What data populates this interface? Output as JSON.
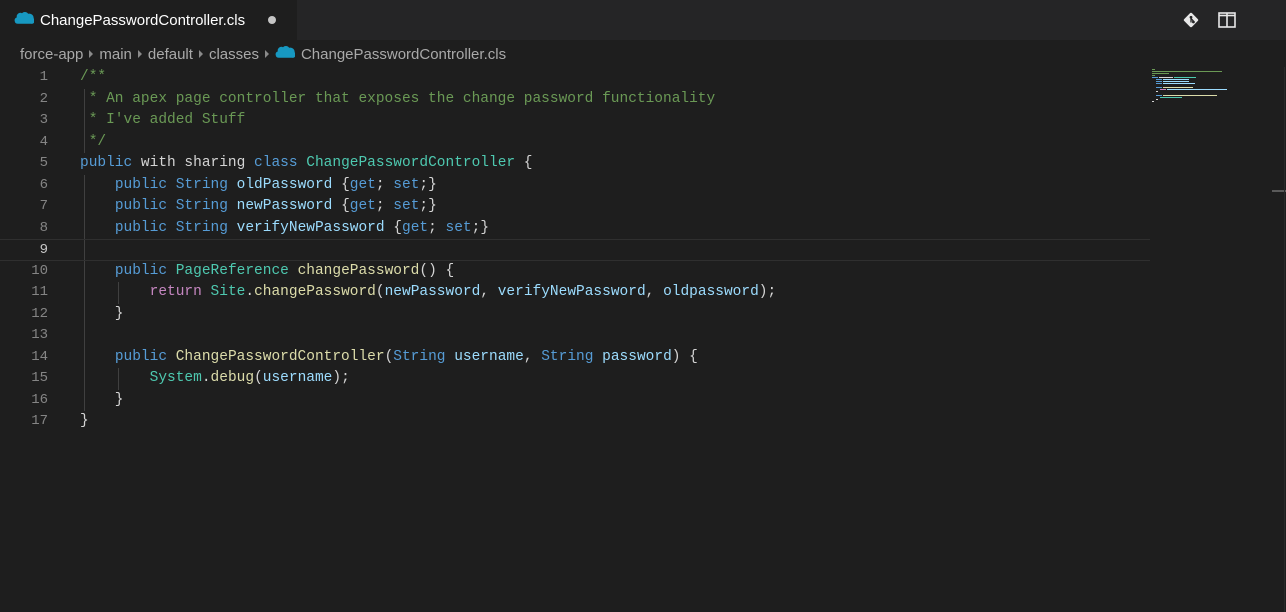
{
  "tab": {
    "title": "ChangePasswordController.cls",
    "icon": "salesforce-cloud-icon",
    "dirty": true
  },
  "actions": [
    {
      "name": "source-control-icon"
    },
    {
      "name": "split-editor-icon"
    }
  ],
  "breadcrumb": [
    "force-app",
    "main",
    "default",
    "classes",
    "ChangePasswordController.cls"
  ],
  "editor": {
    "current_line": 9,
    "lines": [
      {
        "n": "1",
        "tokens": [
          {
            "c": "cm",
            "t": "/**"
          }
        ]
      },
      {
        "n": "2",
        "tokens": [
          {
            "c": "cm",
            "t": " * An apex page controller that exposes the change password functionality"
          }
        ]
      },
      {
        "n": "3",
        "tokens": [
          {
            "c": "cm",
            "t": " * I've added Stuff"
          }
        ]
      },
      {
        "n": "4",
        "tokens": [
          {
            "c": "cm",
            "t": " */"
          }
        ]
      },
      {
        "n": "5",
        "tokens": [
          {
            "c": "kw",
            "t": "public"
          },
          {
            "c": "",
            "t": " with sharing "
          },
          {
            "c": "kw",
            "t": "class"
          },
          {
            "c": "",
            "t": " "
          },
          {
            "c": "ty",
            "t": "ChangePasswordController"
          },
          {
            "c": "",
            "t": " {"
          }
        ]
      },
      {
        "n": "6",
        "tokens": [
          {
            "c": "",
            "t": "    "
          },
          {
            "c": "kw",
            "t": "public"
          },
          {
            "c": "",
            "t": " "
          },
          {
            "c": "kw",
            "t": "String"
          },
          {
            "c": "",
            "t": " "
          },
          {
            "c": "va",
            "t": "oldPassword"
          },
          {
            "c": "",
            "t": " {"
          },
          {
            "c": "kw",
            "t": "get"
          },
          {
            "c": "",
            "t": "; "
          },
          {
            "c": "kw",
            "t": "set"
          },
          {
            "c": "",
            "t": ";}"
          }
        ]
      },
      {
        "n": "7",
        "tokens": [
          {
            "c": "",
            "t": "    "
          },
          {
            "c": "kw",
            "t": "public"
          },
          {
            "c": "",
            "t": " "
          },
          {
            "c": "kw",
            "t": "String"
          },
          {
            "c": "",
            "t": " "
          },
          {
            "c": "va",
            "t": "newPassword"
          },
          {
            "c": "",
            "t": " {"
          },
          {
            "c": "kw",
            "t": "get"
          },
          {
            "c": "",
            "t": "; "
          },
          {
            "c": "kw",
            "t": "set"
          },
          {
            "c": "",
            "t": ";}"
          }
        ]
      },
      {
        "n": "8",
        "tokens": [
          {
            "c": "",
            "t": "    "
          },
          {
            "c": "kw",
            "t": "public"
          },
          {
            "c": "",
            "t": " "
          },
          {
            "c": "kw",
            "t": "String"
          },
          {
            "c": "",
            "t": " "
          },
          {
            "c": "va",
            "t": "verifyNewPassword"
          },
          {
            "c": "",
            "t": " {"
          },
          {
            "c": "kw",
            "t": "get"
          },
          {
            "c": "",
            "t": "; "
          },
          {
            "c": "kw",
            "t": "set"
          },
          {
            "c": "",
            "t": ";}"
          }
        ]
      },
      {
        "n": "9",
        "tokens": []
      },
      {
        "n": "10",
        "tokens": [
          {
            "c": "",
            "t": "    "
          },
          {
            "c": "kw",
            "t": "public"
          },
          {
            "c": "",
            "t": " "
          },
          {
            "c": "ty",
            "t": "PageReference"
          },
          {
            "c": "",
            "t": " "
          },
          {
            "c": "fn",
            "t": "changePassword"
          },
          {
            "c": "",
            "t": "() {"
          }
        ]
      },
      {
        "n": "11",
        "tokens": [
          {
            "c": "",
            "t": "        "
          },
          {
            "c": "ctl",
            "t": "return"
          },
          {
            "c": "",
            "t": " "
          },
          {
            "c": "ty",
            "t": "Site"
          },
          {
            "c": "",
            "t": "."
          },
          {
            "c": "fn",
            "t": "changePassword"
          },
          {
            "c": "",
            "t": "("
          },
          {
            "c": "va",
            "t": "newPassword"
          },
          {
            "c": "",
            "t": ", "
          },
          {
            "c": "va",
            "t": "verifyNewPassword"
          },
          {
            "c": "",
            "t": ", "
          },
          {
            "c": "va",
            "t": "oldpassword"
          },
          {
            "c": "",
            "t": ");"
          }
        ]
      },
      {
        "n": "12",
        "tokens": [
          {
            "c": "",
            "t": "    }"
          }
        ]
      },
      {
        "n": "13",
        "tokens": []
      },
      {
        "n": "14",
        "tokens": [
          {
            "c": "",
            "t": "    "
          },
          {
            "c": "kw",
            "t": "public"
          },
          {
            "c": "",
            "t": " "
          },
          {
            "c": "fn",
            "t": "ChangePasswordController"
          },
          {
            "c": "",
            "t": "("
          },
          {
            "c": "kw",
            "t": "String"
          },
          {
            "c": "",
            "t": " "
          },
          {
            "c": "va",
            "t": "username"
          },
          {
            "c": "",
            "t": ", "
          },
          {
            "c": "kw",
            "t": "String"
          },
          {
            "c": "",
            "t": " "
          },
          {
            "c": "va",
            "t": "password"
          },
          {
            "c": "",
            "t": ") {"
          }
        ]
      },
      {
        "n": "15",
        "tokens": [
          {
            "c": "",
            "t": "        "
          },
          {
            "c": "ty",
            "t": "System"
          },
          {
            "c": "",
            "t": "."
          },
          {
            "c": "fn",
            "t": "debug"
          },
          {
            "c": "",
            "t": "("
          },
          {
            "c": "va",
            "t": "username"
          },
          {
            "c": "",
            "t": ");"
          }
        ]
      },
      {
        "n": "16",
        "tokens": [
          {
            "c": "",
            "t": "    }"
          }
        ]
      },
      {
        "n": "17",
        "tokens": [
          {
            "c": "",
            "t": "}"
          }
        ]
      }
    ]
  },
  "colors": {
    "keyword": "#569cd6",
    "control": "#c586c0",
    "type": "#4ec9b0",
    "function": "#dcdcaa",
    "variable": "#9cdcfe",
    "comment": "#6a9955",
    "text": "#d4d4d4",
    "salesforce": "#1798c1"
  }
}
